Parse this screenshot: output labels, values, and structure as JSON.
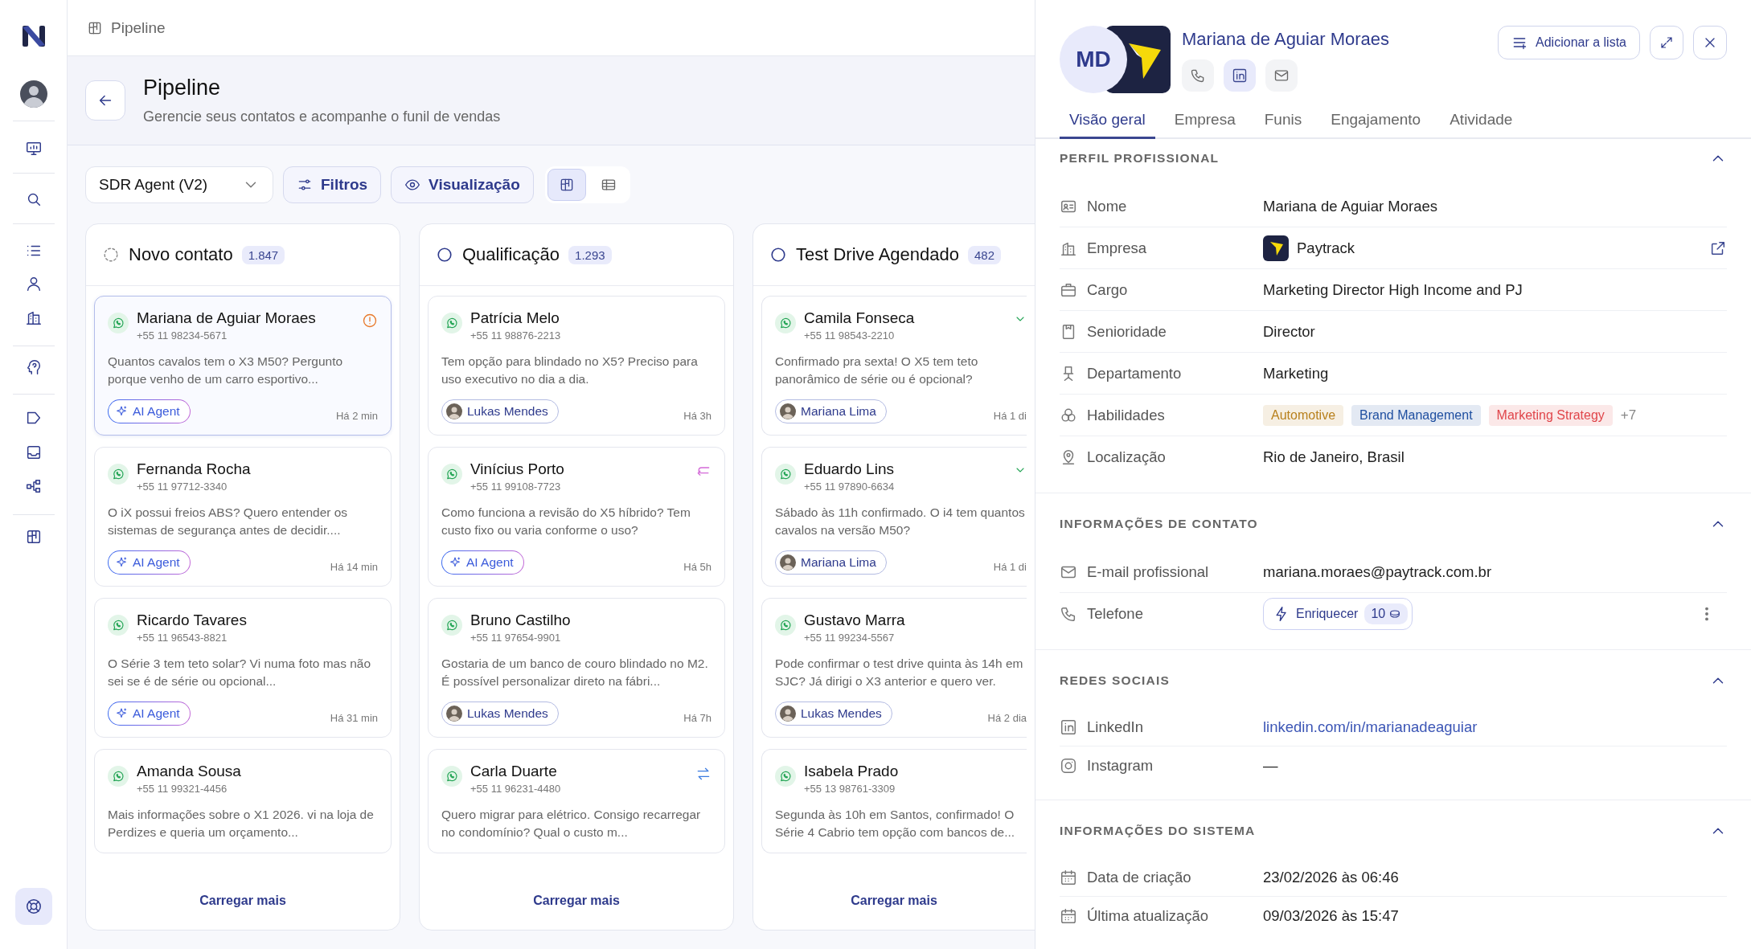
{
  "breadcrumb": "Pipeline",
  "header": {
    "title": "Pipeline",
    "subtitle": "Gerencie seus contatos e acompanhe o funil de vendas"
  },
  "toolbar": {
    "funnel": "SDR Agent (V2)",
    "filters": "Filtros",
    "view": "Visualização",
    "view_modes": [
      {
        "kind": "board",
        "selected": true
      },
      {
        "kind": "table",
        "selected": false
      }
    ]
  },
  "columns": [
    {
      "title": "Novo contato",
      "count": "1.847",
      "kind": "new",
      "load_more": "Carregar mais",
      "cards": [
        {
          "name": "Mariana de Aguiar Moraes",
          "phone": "+55 11 98234-5671",
          "message": "Quantos cavalos tem o X3 M50? Pergunto porque venho de um carro esportivo...",
          "owner": {
            "kind": "ai",
            "label": "AI Agent"
          },
          "time": "Há 2 min",
          "indicator": {
            "kind": "alert"
          },
          "selected": true
        },
        {
          "name": "Fernanda Rocha",
          "phone": "+55 11 97712-3340",
          "message": "O iX possui freios ABS? Quero entender os sistemas de segurança antes de decidir....",
          "owner": {
            "kind": "ai",
            "label": "AI Agent"
          },
          "time": "Há 14 min",
          "selected": false
        },
        {
          "name": "Ricardo Tavares",
          "phone": "+55 11 96543-8821",
          "message": "O Série 3 tem teto solar? Vi numa foto mas não sei se é de série ou opcional...",
          "owner": {
            "kind": "ai",
            "label": "AI Agent"
          },
          "time": "Há 31 min",
          "selected": false
        },
        {
          "name": "Amanda Sousa",
          "phone": "+55 11 99321-4456",
          "message": "Mais informações sobre o X1 2026. vi na loja de Perdizes e queria um orçamento...",
          "selected": false
        }
      ]
    },
    {
      "title": "Qualificação",
      "count": "1.293",
      "kind": "open",
      "load_more": "Carregar mais",
      "cards": [
        {
          "name": "Patrícia Melo",
          "phone": "+55 11 98876-2213",
          "message": "Tem opção para blindado no X5? Preciso para uso executivo no dia a dia.",
          "owner": {
            "kind": "person",
            "label": "Lukas Mendes"
          },
          "time": "Há 3h",
          "selected": false
        },
        {
          "name": "Vinícius Porto",
          "phone": "+55 11 99108-7723",
          "message": "Como funciona a revisão do X5 híbrido? Tem custo fixo ou varia conforme o uso?",
          "owner": {
            "kind": "ai",
            "label": "AI Agent"
          },
          "time": "Há 5h",
          "indicator": {
            "kind": "reply"
          },
          "selected": false
        },
        {
          "name": "Bruno Castilho",
          "phone": "+55 11 97654-9901",
          "message": "Gostaria de um banco de couro blindado no M2. É possível personalizar direto na fábri...",
          "owner": {
            "kind": "person",
            "label": "Lukas Mendes"
          },
          "time": "Há 7h",
          "selected": false
        },
        {
          "name": "Carla Duarte",
          "phone": "+55 11 96231-4480",
          "message": "Quero migrar para elétrico. Consigo recarregar no condomínio? Qual o custo m...",
          "indicator": {
            "kind": "swap"
          },
          "selected": false
        }
      ]
    },
    {
      "title": "Test Drive Agendado",
      "count": "482",
      "kind": "open",
      "load_more": "Carregar mais",
      "cards": [
        {
          "name": "Camila Fonseca",
          "phone": "+55 11 98543-2210",
          "message": "Confirmado pra sexta! O X5 tem teto panorâmico de série ou é opcional?",
          "owner": {
            "kind": "person",
            "label": "Mariana Lima"
          },
          "time": "Há 1 di",
          "indicator": {
            "kind": "confirmed"
          },
          "selected": false
        },
        {
          "name": "Eduardo Lins",
          "phone": "+55 11 97890-6634",
          "message": "Sábado às 11h confirmado. O i4 tem quantos cavalos na versão M50?",
          "owner": {
            "kind": "person",
            "label": "Mariana Lima"
          },
          "time": "Há 1 di",
          "indicator": {
            "kind": "confirmed"
          },
          "selected": false
        },
        {
          "name": "Gustavo Marra",
          "phone": "+55 11 99234-5567",
          "message": "Pode confirmar o test drive quinta às 14h em SJC? Já dirigi o X3 anterior e quero ver.",
          "owner": {
            "kind": "person",
            "label": "Lukas Mendes"
          },
          "time": "Há 2 dia",
          "selected": false
        },
        {
          "name": "Isabela Prado",
          "phone": "+55 13 98761-3309",
          "message": "Segunda às 10h em Santos, confirmado! O Série 4 Cabrio tem opção com bancos de...",
          "selected": false
        }
      ]
    }
  ],
  "detail": {
    "initials": "MD",
    "name": "Mariana de Aguiar Moraes",
    "contact_actions": [
      {
        "kind": "phone",
        "selected": false
      },
      {
        "kind": "linkedin",
        "selected": true
      },
      {
        "kind": "email",
        "selected": false
      }
    ],
    "add_to_list": "Adicionar a lista",
    "tabs": [
      {
        "label": "Visão geral",
        "selected": true
      },
      {
        "label": "Empresa",
        "selected": false
      },
      {
        "label": "Funis",
        "selected": false
      },
      {
        "label": "Engajamento",
        "selected": false
      },
      {
        "label": "Atividade",
        "selected": false
      }
    ],
    "sections": [
      {
        "title": "PERFIL PROFISSIONAL",
        "expanded": true,
        "rows": [
          {
            "label": "Nome",
            "kind": "text",
            "value": "Mariana de Aguiar Moraes"
          },
          {
            "label": "Empresa",
            "kind": "company",
            "value": "Paytrack"
          },
          {
            "label": "Cargo",
            "kind": "text",
            "value": "Marketing Director High Income and PJ"
          },
          {
            "label": "Senioridade",
            "kind": "text",
            "value": "Director"
          },
          {
            "label": "Departamento",
            "kind": "text",
            "value": "Marketing"
          },
          {
            "label": "Habilidades",
            "kind": "tags",
            "tags": [
              {
                "label": "Automotive",
                "color": "#b8801d"
              },
              {
                "label": "Brand Management",
                "color": "#1f4fa0"
              },
              {
                "label": "Marketing Strategy",
                "color": "#e0454a"
              }
            ],
            "more": "+7"
          },
          {
            "label": "Localização",
            "kind": "text",
            "value": "Rio de Janeiro, Brasil"
          }
        ]
      },
      {
        "title": "INFORMAÇÕES DE CONTATO",
        "expanded": true,
        "rows": [
          {
            "label": "E-mail profissional",
            "kind": "text",
            "value": "mariana.moraes@paytrack.com.br"
          },
          {
            "label": "Telefone",
            "kind": "enrich",
            "button": "Enriquecer",
            "credits": "10"
          }
        ]
      },
      {
        "title": "REDES SOCIAIS",
        "expanded": true,
        "rows": [
          {
            "label": "LinkedIn",
            "kind": "link",
            "value": "linkedin.com/in/marianadeaguiar"
          },
          {
            "label": "Instagram",
            "kind": "text",
            "value": "—"
          }
        ]
      },
      {
        "title": "INFORMAÇÕES DO SISTEMA",
        "expanded": true,
        "rows": [
          {
            "label": "Data de criação",
            "kind": "text",
            "value": "23/02/2026 às 06:46"
          },
          {
            "label": "Última atualização",
            "kind": "text",
            "value": "09/03/2026 às 15:47"
          }
        ]
      }
    ]
  }
}
